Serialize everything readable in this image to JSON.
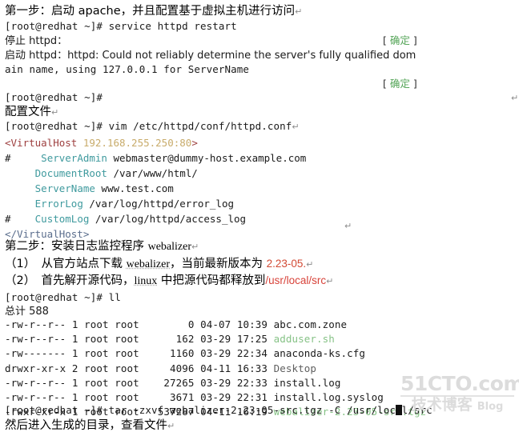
{
  "document": {
    "heading_step1": "第一步：启动 apache，并且配置基于虚拟主机进行访问",
    "label_config_file": "配置文件",
    "heading_step2_prefix": "第二步：安装日志监控程序 ",
    "heading_step2_term": "webalizer",
    "item1_a": "（1）　从官方站点下载 ",
    "item1_term": "webalizer",
    "item1_b": "，当前最新版本为 ",
    "item1_version": "2.23-05.",
    "item2_a": "（2）　首先解开源代码，",
    "item2_term": "linux",
    "item2_b": " 中把源代码都释放到",
    "item2_path": "/usr/local/src",
    "closing_line": "然后进入生成的目录，查看文件",
    "return_mark": "↵"
  },
  "terminal": {
    "prompt": "[root@redhat ~]#",
    "cmd_service_restart": "[root@redhat ~]# service httpd restart",
    "line_stop_httpd": "停止 httpd：",
    "line_start_httpd": "启动 httpd：httpd: Could not reliably determine the server's fully qualified dom",
    "line_start_httpd_wrap": "ain name, using 127.0.0.1 for ServerName",
    "prompt_bare": "[root@redhat ~]#",
    "cmd_vim_httpd_conf": "[root@redhat ~]# vim /etc/httpd/conf/httpd.conf",
    "cmd_ll": "[root@redhat ~]# ll",
    "total_line": "总计 588",
    "cmd_tar": "[root@redhat ~]# tar -zxvf webalizer-2.23-05-src.tgz -C /usr/local/src",
    "ok_marker_open": "[ ",
    "ok_marker_word": "确定",
    "ok_marker_close": " ]"
  },
  "vim_config": {
    "lines": [
      {
        "tag_open": "<VirtualHost ",
        "addr": "192.168.255.250:80",
        "tag_tail": ">"
      },
      {
        "hash": "#",
        "indent": "     ",
        "directive": "ServerAdmin",
        "value": " webmaster@dummy-host.example.com"
      },
      {
        "hash": " ",
        "indent": "    ",
        "directive": "DocumentRoot",
        "value": " /var/www/html/"
      },
      {
        "hash": " ",
        "indent": "    ",
        "directive": "ServerName",
        "value": " www.test.com"
      },
      {
        "hash": " ",
        "indent": "    ",
        "directive": "ErrorLog",
        "value": " /var/log/httpd/error_log"
      },
      {
        "hash": "#",
        "indent": "    ",
        "directive": "CustomLog",
        "value": " /var/log/httpd/access_log"
      }
    ],
    "tag_close": "</VirtualHost>"
  },
  "ls_output": {
    "rows": [
      {
        "perms": "-rw-r--r--",
        "links": "1",
        "owner": "root",
        "group": "root",
        "size": "0",
        "date": "04-07",
        "time": "10:39",
        "name": "abc.com.zone",
        "kind": "plain"
      },
      {
        "perms": "-rw-r--r--",
        "links": "1",
        "owner": "root",
        "group": "root",
        "size": "162",
        "date": "03-29",
        "time": "17:25",
        "name": "adduser.sh",
        "kind": "exec"
      },
      {
        "perms": "-rw-------",
        "links": "1",
        "owner": "root",
        "group": "root",
        "size": "1160",
        "date": "03-29",
        "time": "22:34",
        "name": "anaconda-ks.cfg",
        "kind": "plain"
      },
      {
        "perms": "drwxr-xr-x",
        "links": "2",
        "owner": "root",
        "group": "root",
        "size": "4096",
        "date": "04-11",
        "time": "16:33",
        "name": "Desktop",
        "kind": "dir"
      },
      {
        "perms": "-rw-r--r--",
        "links": "1",
        "owner": "root",
        "group": "root",
        "size": "27265",
        "date": "03-29",
        "time": "22:33",
        "name": "install.log",
        "kind": "plain"
      },
      {
        "perms": "-rw-r--r--",
        "links": "1",
        "owner": "root",
        "group": "root",
        "size": "3671",
        "date": "03-29",
        "time": "22:31",
        "name": "install.log.syslog",
        "kind": "plain"
      },
      {
        "perms": "-rwxr-xr-x",
        "links": "1",
        "owner": "root",
        "group": "root",
        "size": "537287",
        "date": "04-11",
        "time": "16:19",
        "name": "webalizer-2.23-05-src.tgz",
        "kind": "exec"
      }
    ]
  },
  "watermark": {
    "site": "51CTO.com",
    "tagline_cn": "技术博客",
    "tagline_en": "Blog"
  },
  "colors": {
    "ok_green": "#55a558",
    "exec_green": "#86c286",
    "accent_red": "#d8433a",
    "vim_directive": "#3f9a9e",
    "vim_tag_open": "#9e4040",
    "vim_addr": "#c8ab6a",
    "vim_tag_close": "#5a6d8c",
    "watermark_grey": "#dcdcdc"
  }
}
